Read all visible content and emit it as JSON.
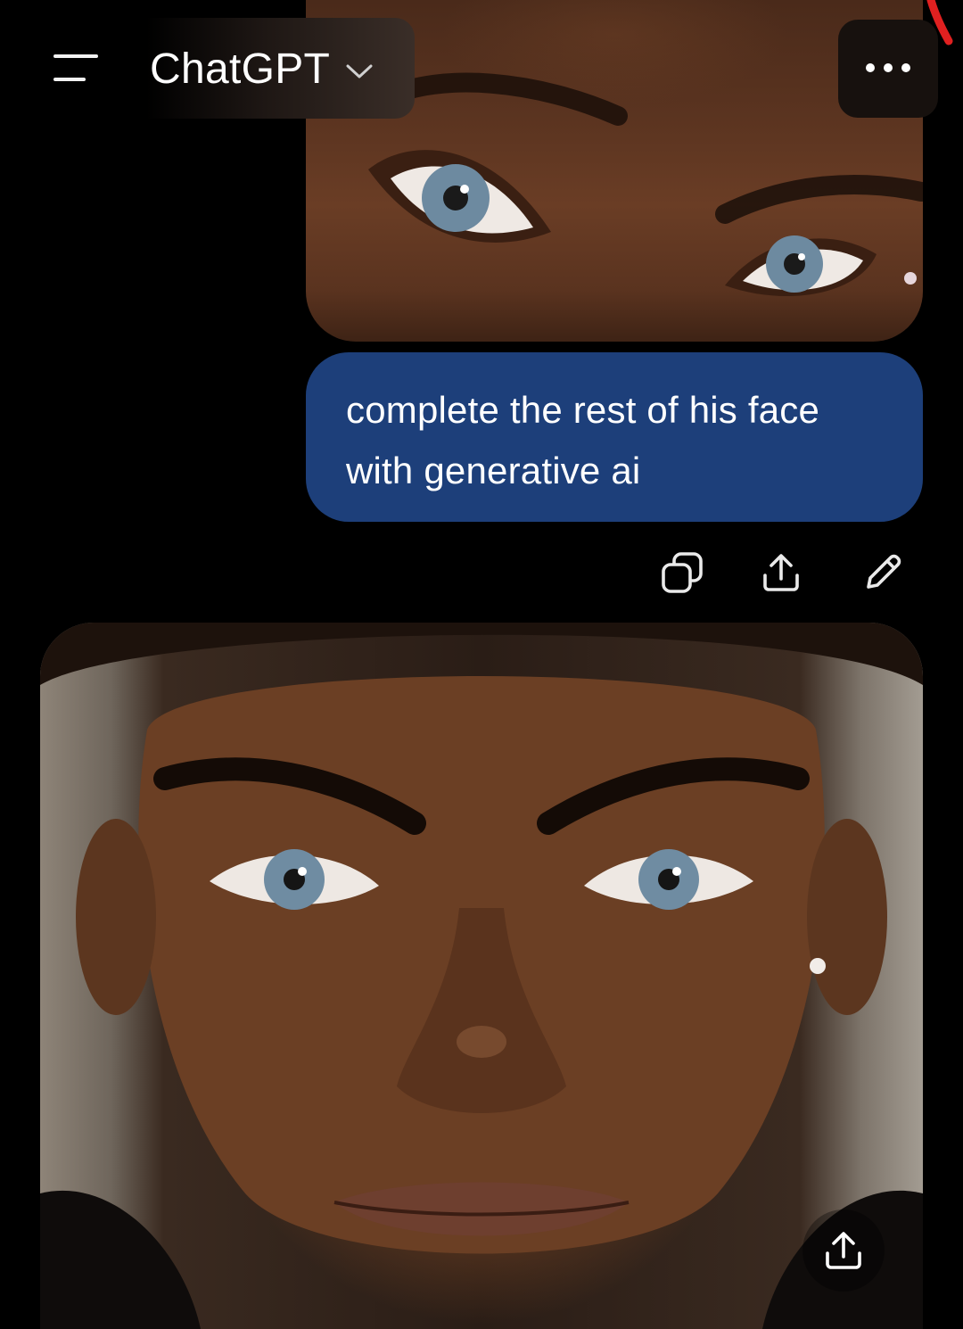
{
  "header": {
    "menu_icon": "menu-icon",
    "title": "ChatGPT",
    "dropdown_icon": "chevron-down-icon",
    "more_icon": "more-horizontal-icon"
  },
  "conversation": {
    "user_image": {
      "description_icon": "image"
    },
    "user_message": "complete the rest of his face with generative ai",
    "actions": [
      "copy-icon",
      "share-icon",
      "edit-icon"
    ],
    "bubble_color": "#1d3f7a",
    "generated_image": {
      "share_icon": "share-icon"
    }
  }
}
